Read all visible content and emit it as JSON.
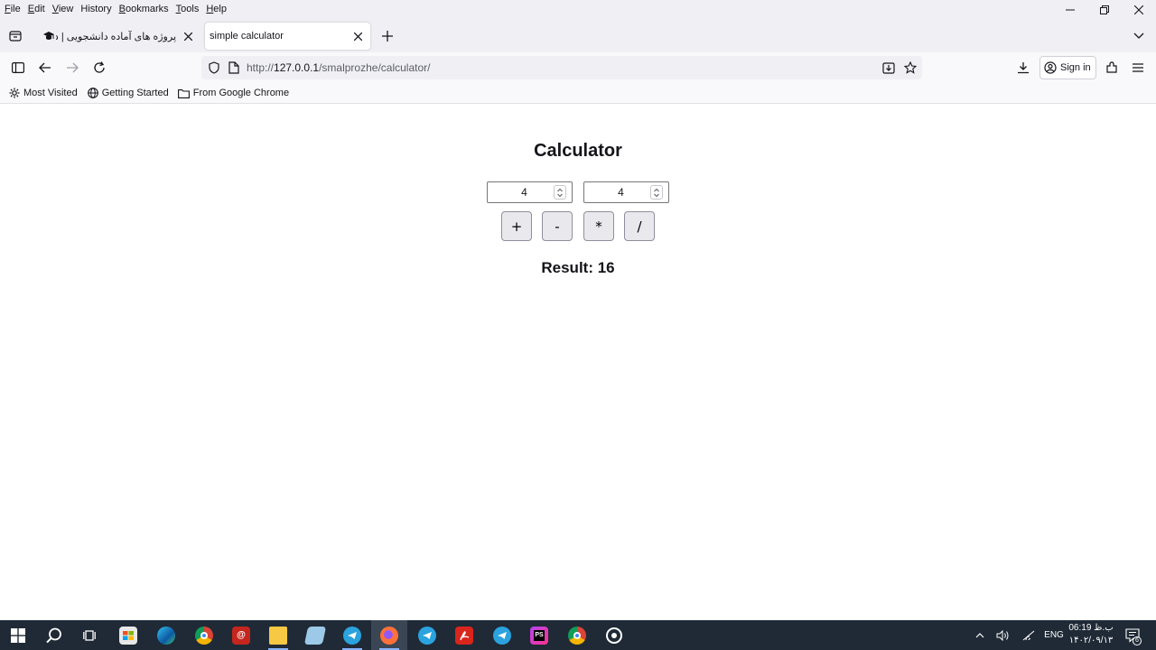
{
  "menubar": {
    "items": [
      {
        "ul": "F",
        "rest": "ile"
      },
      {
        "ul": "E",
        "rest": "dit"
      },
      {
        "ul": "V",
        "rest": "iew"
      },
      {
        "ul": "",
        "rest": "History"
      },
      {
        "ul": "B",
        "rest": "ookmarks"
      },
      {
        "ul": "T",
        "rest": "ools"
      },
      {
        "ul": "H",
        "rest": "elp"
      }
    ]
  },
  "tabs": {
    "inactive_title": "پروژه های آماده دانشجویی | دانلو",
    "active_title": "simple calculator"
  },
  "urlbar": {
    "prefix": "http://",
    "host": "127.0.0.1",
    "path": "/smalprozhe/calculator/"
  },
  "toolbar": {
    "signin_label": "Sign in"
  },
  "bookmarks": {
    "items": [
      "Most Visited",
      "Getting Started",
      "From Google Chrome"
    ]
  },
  "calculator": {
    "title": "Calculator",
    "input1_value": "4",
    "input2_value": "4",
    "ops": [
      "+",
      "-",
      "*",
      "/"
    ],
    "result_text": "Result: 16"
  },
  "taskbar": {
    "lang": "ENG",
    "time": "06:19 ب.ظ",
    "date": "۱۴۰۲/۰۹/۱۳",
    "notif_count": "6"
  },
  "colors": {
    "accent": "#0061e0",
    "taskbar_bg": "#1f2a36"
  }
}
